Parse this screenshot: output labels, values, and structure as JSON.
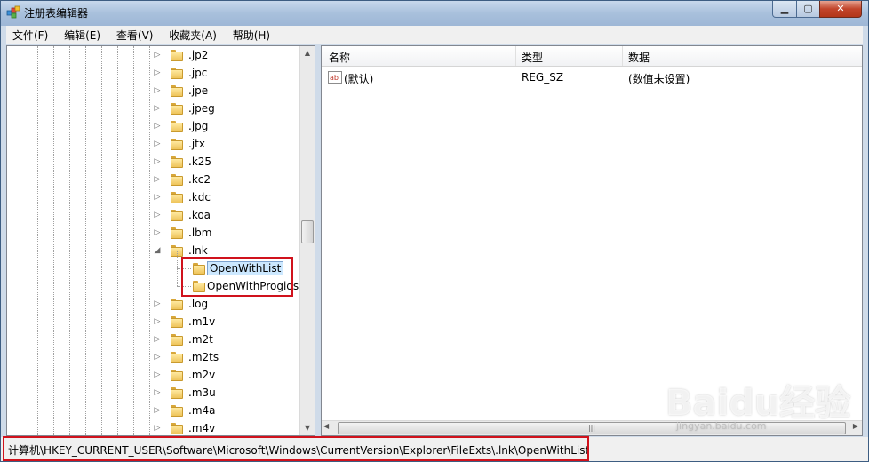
{
  "window": {
    "title": "注册表编辑器"
  },
  "menu": [
    "文件(F)",
    "编辑(E)",
    "查看(V)",
    "收藏夹(A)",
    "帮助(H)"
  ],
  "tree": {
    "items": [
      {
        "label": ".jp2",
        "expander": "▷"
      },
      {
        "label": ".jpc",
        "expander": "▷"
      },
      {
        "label": ".jpe",
        "expander": "▷"
      },
      {
        "label": ".jpeg",
        "expander": "▷"
      },
      {
        "label": ".jpg",
        "expander": "▷"
      },
      {
        "label": ".jtx",
        "expander": "▷"
      },
      {
        "label": ".k25",
        "expander": "▷"
      },
      {
        "label": ".kc2",
        "expander": "▷"
      },
      {
        "label": ".kdc",
        "expander": "▷"
      },
      {
        "label": ".koa",
        "expander": "▷"
      },
      {
        "label": ".lbm",
        "expander": "▷"
      },
      {
        "label": ".lnk",
        "expander": "◢"
      },
      {
        "label": "OpenWithList",
        "child": true,
        "selected": true
      },
      {
        "label": "OpenWithProgids",
        "child": true
      },
      {
        "label": ".log",
        "expander": "▷"
      },
      {
        "label": ".m1v",
        "expander": "▷"
      },
      {
        "label": ".m2t",
        "expander": "▷"
      },
      {
        "label": ".m2ts",
        "expander": "▷"
      },
      {
        "label": ".m2v",
        "expander": "▷"
      },
      {
        "label": ".m3u",
        "expander": "▷"
      },
      {
        "label": ".m4a",
        "expander": "▷"
      },
      {
        "label": ".m4v",
        "expander": "▷"
      }
    ]
  },
  "list": {
    "headers": [
      "名称",
      "类型",
      "数据"
    ],
    "rows": [
      {
        "name": "(默认)",
        "icon": "ab",
        "type": "REG_SZ",
        "data": "(数值未设置)"
      }
    ]
  },
  "status": {
    "path": "计算机\\HKEY_CURRENT_USER\\Software\\Microsoft\\Windows\\CurrentVersion\\Explorer\\FileExts\\.lnk\\OpenWithList"
  },
  "watermark": {
    "brand": "Baidu经验",
    "url": "jingyan.baidu.com"
  },
  "colors": {
    "highlight": "#d0121c",
    "selection": "#cce8ff"
  }
}
